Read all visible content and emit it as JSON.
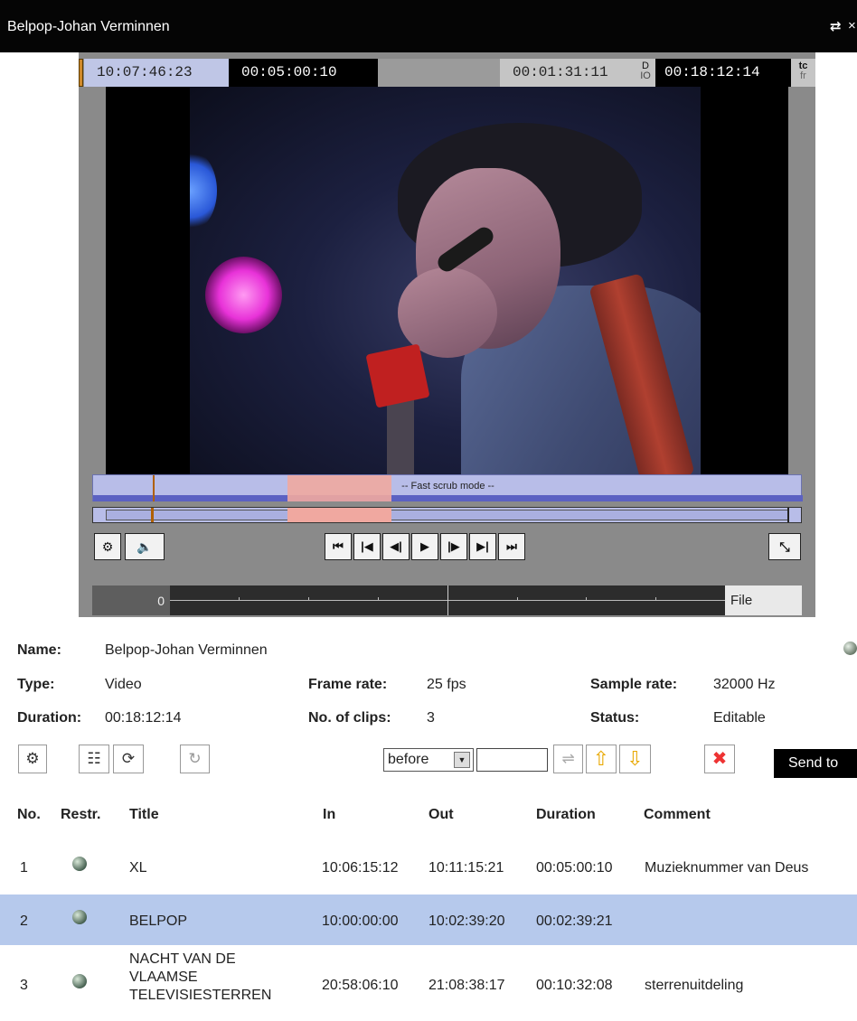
{
  "window": {
    "title": "Belpop-Johan Verminnen"
  },
  "timecodes": {
    "current": "10:07:46:23",
    "duration": "00:05:00:10",
    "position": "00:01:31:11",
    "d_label": "D",
    "io_label": "IO",
    "end": "00:18:12:14",
    "tc_label": "tc",
    "fr_label": "fr"
  },
  "player": {
    "scrub_label": "-- Fast scrub mode --",
    "transport": [
      "⏮",
      "|◀",
      "◀|",
      "▶",
      "|▶",
      "▶|",
      "⏭"
    ],
    "timeline_start": "0",
    "timeline_mode": "File"
  },
  "metadata": {
    "name_label": "Name:",
    "name": "Belpop-Johan Verminnen",
    "type_label": "Type:",
    "type": "Video",
    "framerate_label": "Frame rate:",
    "framerate": "25 fps",
    "samplerate_label": "Sample rate:",
    "samplerate": "32000 Hz",
    "duration_label": "Duration:",
    "duration": "00:18:12:14",
    "clips_label": "No. of clips:",
    "clips": "3",
    "status_label": "Status:",
    "status": "Editable"
  },
  "toolbar": {
    "position_select": "before",
    "clip_input_value": "",
    "send_to": "Send to"
  },
  "table": {
    "headers": {
      "no": "No.",
      "restr": "Restr.",
      "title": "Title",
      "in": "In",
      "out": "Out",
      "duration": "Duration",
      "comment": "Comment"
    },
    "rows": [
      {
        "no": "1",
        "title": "XL",
        "in": "10:06:15:12",
        "out": "10:11:15:21",
        "duration": "00:05:00:10",
        "comment": "Muzieknummer van Deus"
      },
      {
        "no": "2",
        "title": "BELPOP",
        "in": "10:00:00:00",
        "out": "10:02:39:20",
        "duration": "00:02:39:21",
        "comment": ""
      },
      {
        "no": "3",
        "title_lines": [
          "NACHT VAN DE",
          "VLAAMSE",
          "TELEVISIESTERREN"
        ],
        "in": "20:58:06:10",
        "out": "21:08:38:17",
        "duration": "00:10:32:08",
        "comment": "sterrenuitdeling"
      }
    ]
  },
  "colors": {
    "selected_row": "#b6c9ec",
    "titlebar": "#050505",
    "player_bg": "#8a8a8a",
    "scrub_selection": "#f0a8a0"
  }
}
